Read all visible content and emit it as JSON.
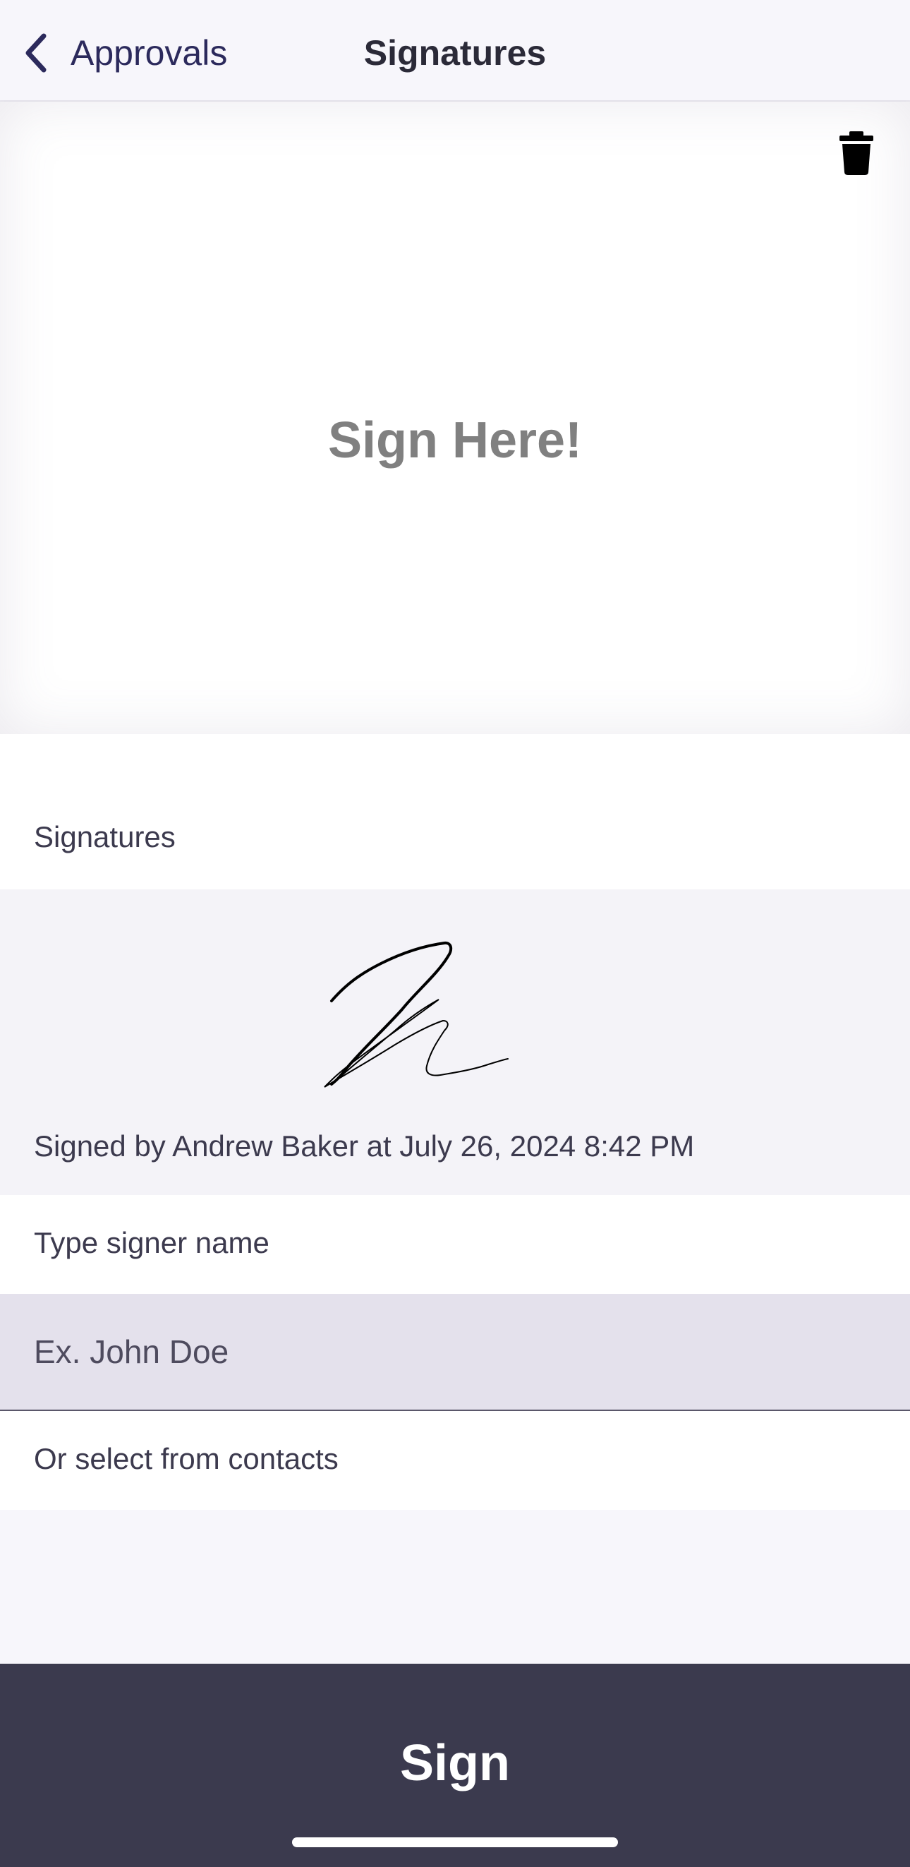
{
  "navbar": {
    "back_label": "Approvals",
    "title": "Signatures"
  },
  "signature_pad": {
    "hint": "Sign Here!",
    "clear_icon": "trash-icon"
  },
  "signatures_section": {
    "label": "Signatures",
    "items": [
      {
        "signed_by_text": "Signed by Andrew Baker at July 26, 2024 8:42 PM"
      }
    ]
  },
  "signer": {
    "type_label": "Type signer name",
    "input_value": "",
    "input_placeholder": "Ex. John Doe",
    "contacts_label": "Or select from contacts"
  },
  "actions": {
    "sign_label": "Sign"
  }
}
